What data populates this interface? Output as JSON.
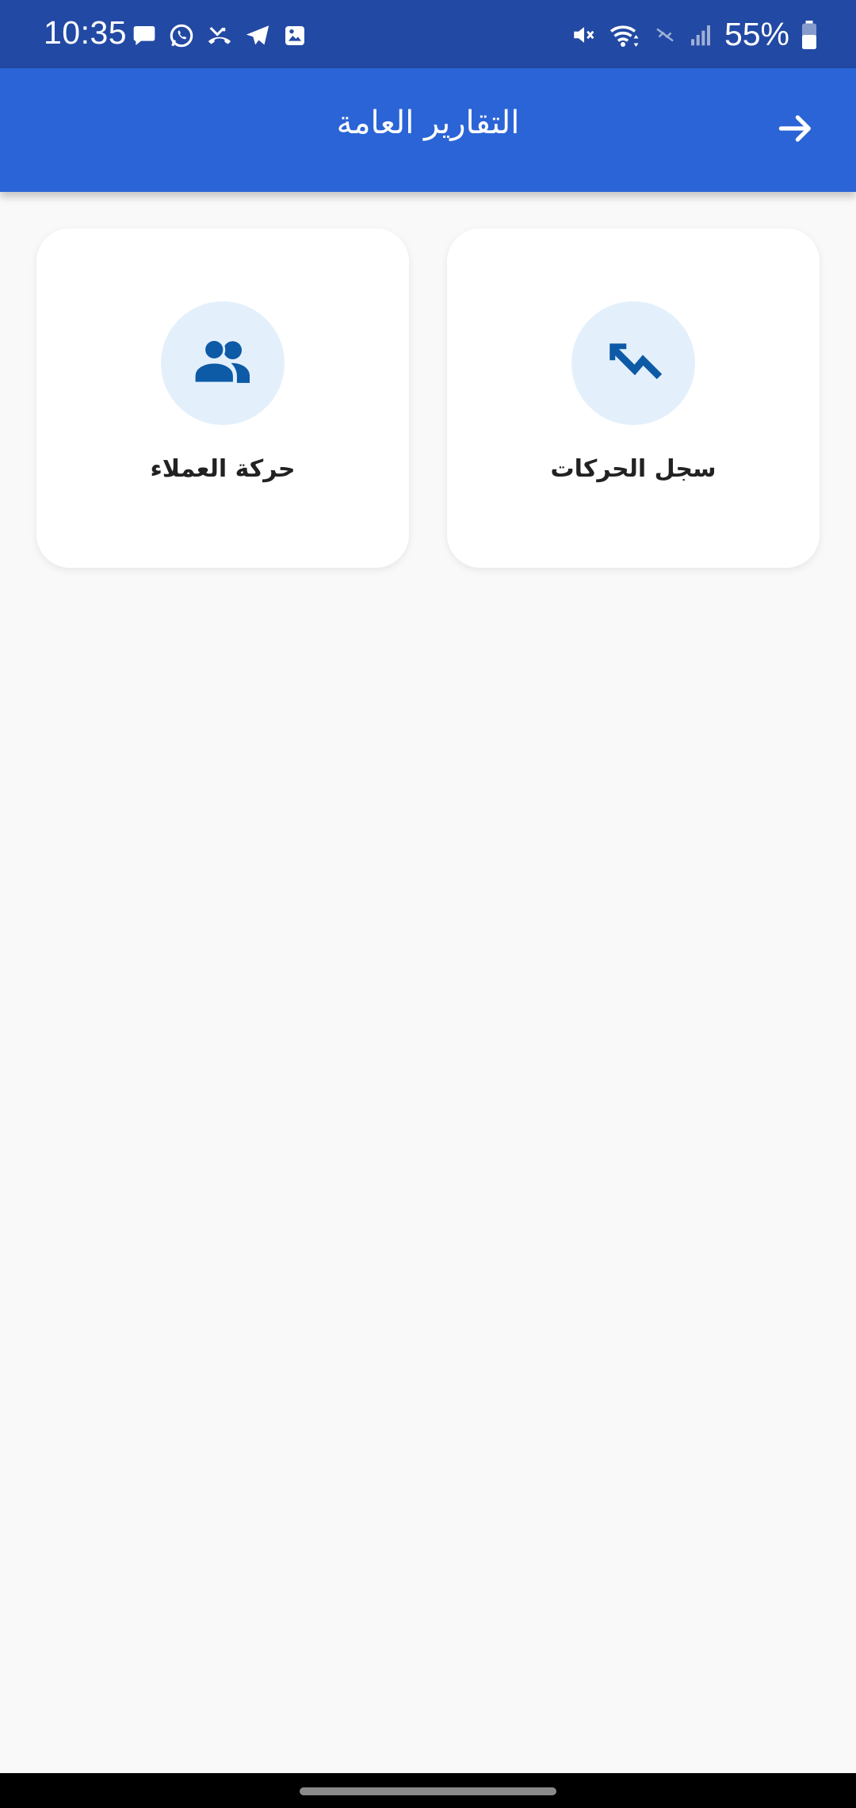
{
  "status_bar": {
    "time": "10:35",
    "battery": "55%",
    "left_icons": [
      "message-icon",
      "whatsapp-icon",
      "missed-call-icon",
      "telegram-icon",
      "gallery-icon"
    ],
    "right_icons": [
      "mute-icon",
      "wifi-icon",
      "data-off-icon",
      "signal-icon",
      "battery-icon"
    ]
  },
  "app_bar": {
    "title": "التقارير العامة",
    "back_icon": "arrow-right-icon"
  },
  "cards": [
    {
      "label": "سجل الحركات",
      "icon": "trending-down-arrow-icon"
    },
    {
      "label": "حركة العملاء",
      "icon": "people-icon"
    }
  ],
  "colors": {
    "status_bar": "#2249a3",
    "app_bar": "#2b64d6",
    "background": "#f9f9f9",
    "card": "#ffffff",
    "icon_circle": "#e3f0fb",
    "icon": "#0d5aa7"
  }
}
